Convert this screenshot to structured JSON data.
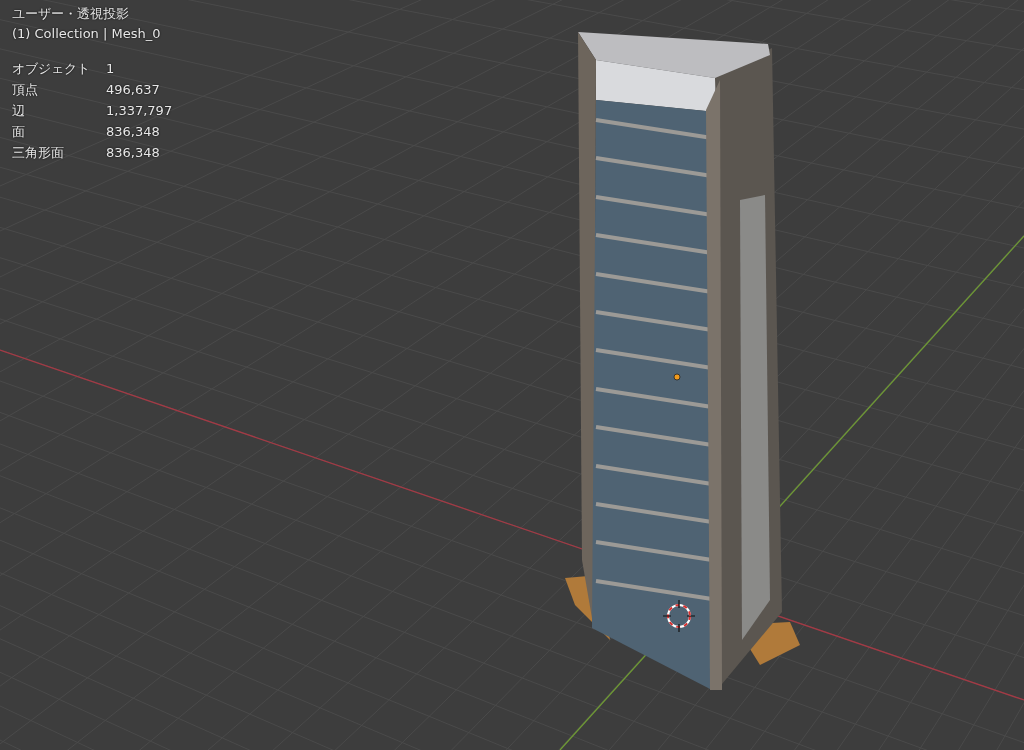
{
  "viewport": {
    "view_name": "ユーザー・透視投影",
    "collection_label": "(1) Collection | Mesh_0",
    "statistics": [
      {
        "label": "オブジェクト",
        "value": "1"
      },
      {
        "label": "頂点",
        "value": "496,637"
      },
      {
        "label": "辺",
        "value": "1,337,797"
      },
      {
        "label": "面",
        "value": "836,348"
      },
      {
        "label": "三角形面",
        "value": "836,348"
      }
    ]
  }
}
